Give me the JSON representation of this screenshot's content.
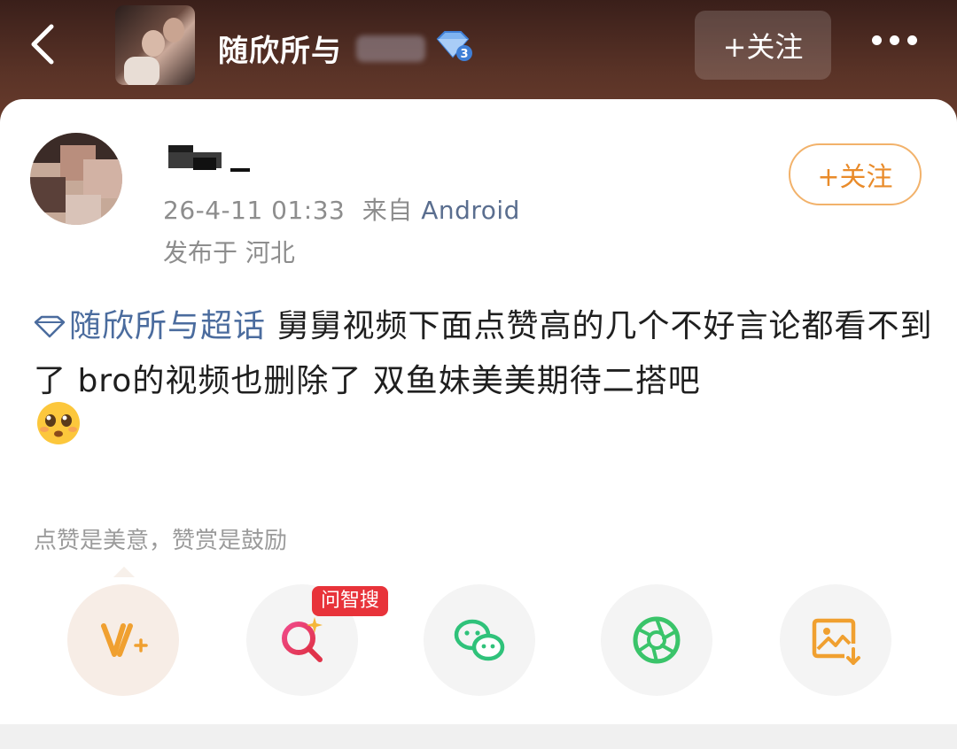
{
  "topbar": {
    "group_title": "随欣所与",
    "follow_label": "+关注",
    "icons": {
      "back": "back-arrow-icon",
      "badge": "diamond-level-badge-icon",
      "more": "more-dots-icon"
    }
  },
  "post": {
    "author_name": "",
    "timestamp": "26-4-11 01:33",
    "from_label": "来自",
    "device": "Android",
    "location": "发布于 河北",
    "follow_label": "+关注",
    "topic": "随欣所与超话",
    "text": " 舅舅视频下面点赞高的几个不好言论都看不到了 bro的视频也删除了 双鱼妹美美期待二搭吧",
    "emoji": "pleading-face-emoji"
  },
  "actions": {
    "like_tip": "点赞是美意，赞赏是鼓励",
    "ai_tag": "问智搜",
    "buttons": [
      {
        "name": "vip-boost",
        "icon": "v-plus-icon",
        "color": "#f0a030"
      },
      {
        "name": "ai-search",
        "icon": "search-sparkle-icon",
        "color": "#e0336a"
      },
      {
        "name": "wechat",
        "icon": "wechat-icon",
        "color": "#2fc27a"
      },
      {
        "name": "moments",
        "icon": "camera-aperture-icon",
        "color": "#3ac46a"
      },
      {
        "name": "save-image",
        "icon": "image-download-icon",
        "color": "#f0a030"
      }
    ]
  },
  "colors": {
    "topbar": "#4a2a22",
    "link": "#4b6c9e",
    "follow_orange": "#e98b2a",
    "ai_tag_red": "#e8333a"
  }
}
